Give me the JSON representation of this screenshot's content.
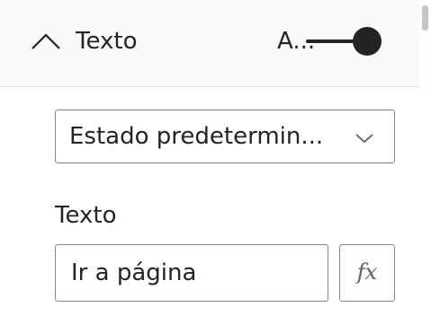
{
  "section": {
    "title": "Texto",
    "toggle_state_label": "A...",
    "toggle_on": true,
    "chevron_icon": "chevron-up-icon"
  },
  "state_dropdown": {
    "value": "Estado predetermin...",
    "chevron_icon": "chevron-down-icon"
  },
  "text_field": {
    "label": "Texto",
    "value": "Ir a página"
  },
  "fx_button": {
    "label": "fx",
    "icon": "fx-icon"
  },
  "colors": {
    "header_bg": "#faf9f8",
    "text": "#252423",
    "border": "#8a8886",
    "toggle": "#252423"
  }
}
